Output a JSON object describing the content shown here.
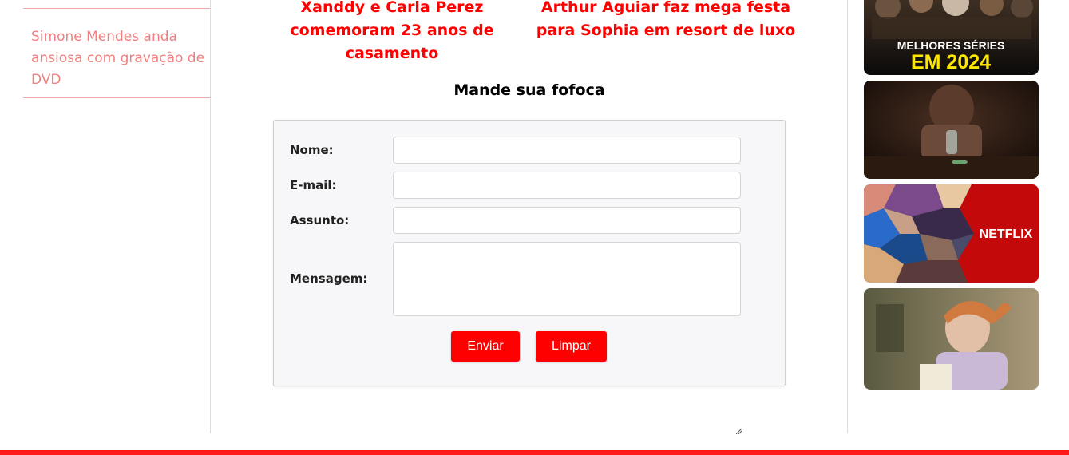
{
  "sidebar": {
    "story_link": "Simone Mendes anda ansiosa com gravação de DVD"
  },
  "headlines": [
    "Xanddy e Carla Perez comemoram 23 anos de casamento",
    "Arthur Aguiar faz mega festa para Sophia em resort de luxo"
  ],
  "form": {
    "title": "Mande sua fofoca",
    "labels": {
      "name": "Nome:",
      "email": "E-mail:",
      "subject": "Assunto:",
      "message": "Mensagem:"
    },
    "values": {
      "name": "",
      "email": "",
      "subject": "",
      "message": ""
    },
    "buttons": {
      "send": "Enviar",
      "clear": "Limpar"
    }
  },
  "thumbnails": [
    {
      "line1": "MELHORES SÉRIES",
      "line2": "EM 2024"
    },
    {},
    {
      "brand": "NETFLIX"
    },
    {}
  ],
  "colors": {
    "accent": "#ff0000",
    "link": "#f08080",
    "form_bg": "#f7f7f9",
    "thumb2_year_text": "#ffe600"
  }
}
